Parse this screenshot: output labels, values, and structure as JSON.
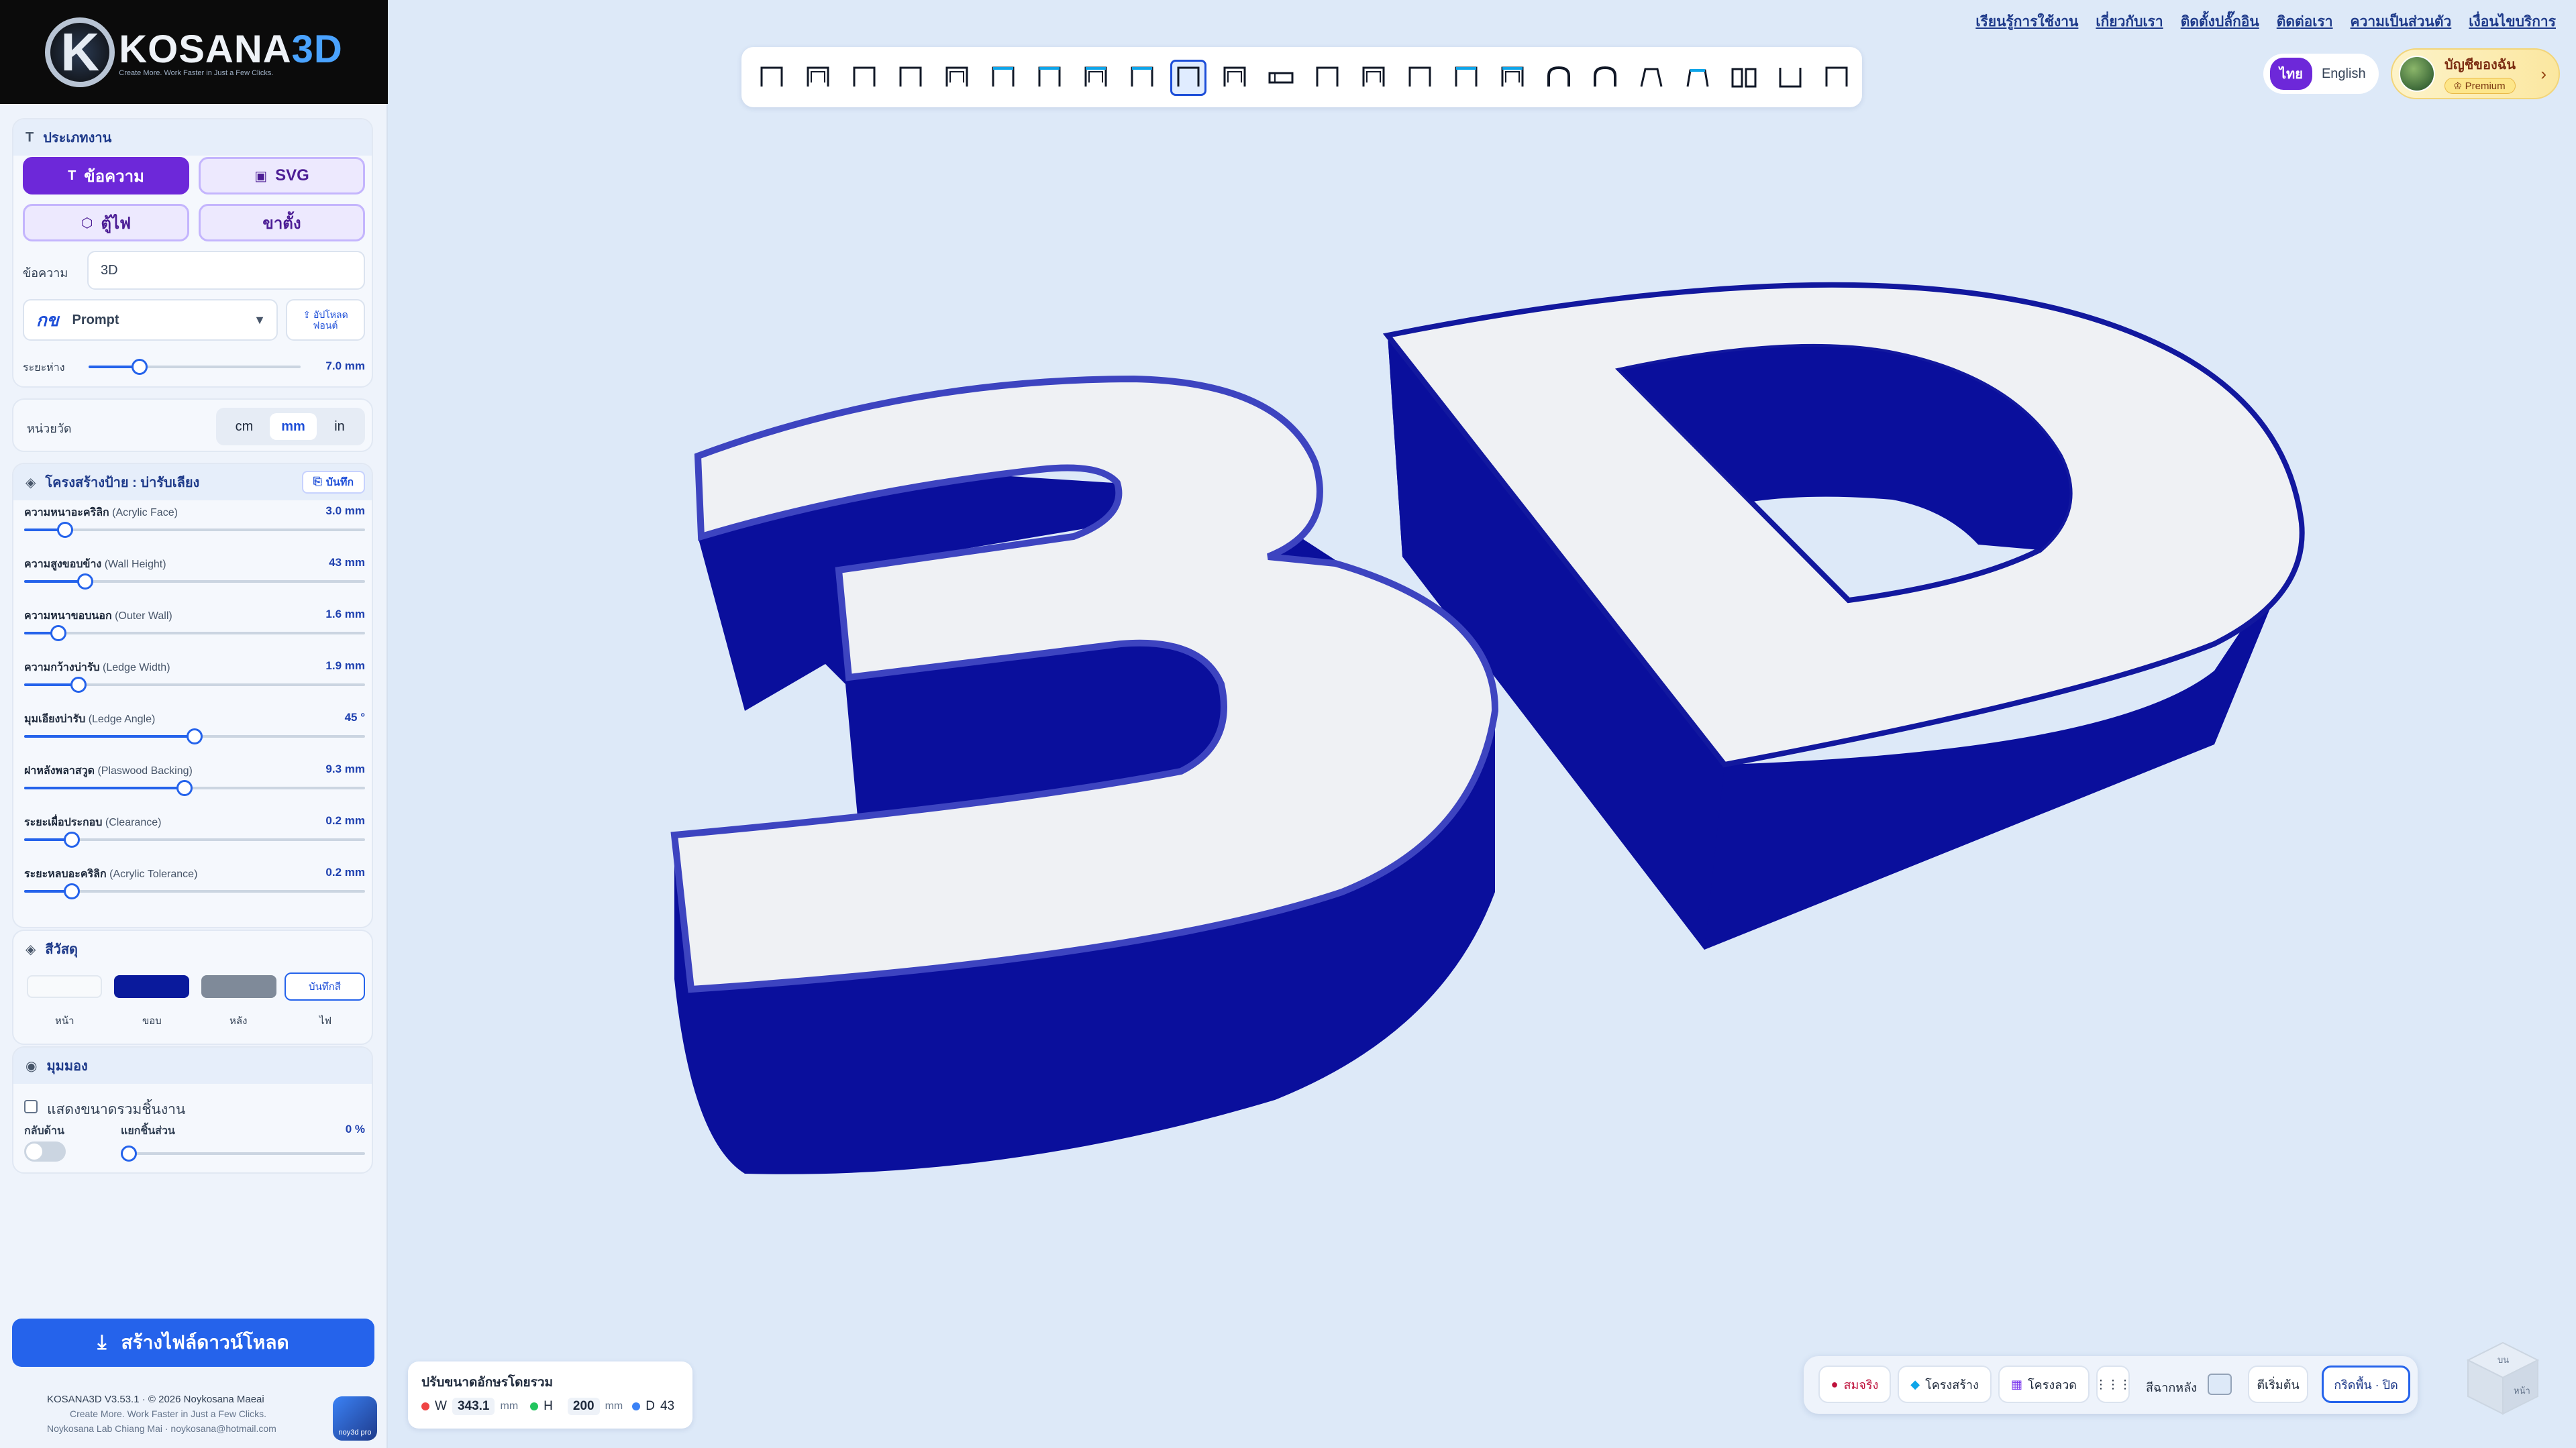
{
  "brand": {
    "name_a": "KOSANA",
    "name_b": "3D",
    "tagline": "Create More. Work Faster in Just a Few Clicks."
  },
  "type_card": {
    "header": "ประเภทงาน",
    "buttons": [
      {
        "label": "ข้อความ",
        "icon": "text-icon",
        "active": true
      },
      {
        "label": "SVG",
        "icon": "image-icon",
        "active": false
      },
      {
        "label": "ตู้ไฟ",
        "icon": "lightbox-icon",
        "active": false
      },
      {
        "label": "ขาตั้ง",
        "icon": "",
        "active": false
      }
    ],
    "text_label": "ข้อความ",
    "text_value": "3D",
    "font_glyph": "กข",
    "font_name": "Prompt",
    "upload_label_1": "อัปโหลด",
    "upload_label_2": "ฟอนต์",
    "spacing_label": "ระยะห่าง",
    "spacing_value": "7.0 mm",
    "spacing_fraction": 0.24
  },
  "units_card": {
    "label": "หน่วยวัด",
    "options": [
      "cm",
      "mm",
      "in"
    ],
    "selected": "mm"
  },
  "structure_card": {
    "header": "โครงสร้างป้าย : บ่ารับเลียง",
    "save_label": "บันทึก",
    "params": [
      {
        "label": "ความหนาอะคริลิก",
        "en": "(Acrylic Face)",
        "value": "3.0 mm",
        "fraction": 0.12
      },
      {
        "label": "ความสูงขอบข้าง",
        "en": "(Wall Height)",
        "value": "43 mm",
        "fraction": 0.18
      },
      {
        "label": "ความหนาขอบนอก",
        "en": "(Outer Wall)",
        "value": "1.6 mm",
        "fraction": 0.1
      },
      {
        "label": "ความกว้างบ่ารับ",
        "en": "(Ledge Width)",
        "value": "1.9 mm",
        "fraction": 0.16
      },
      {
        "label": "มุมเอียงบ่ารับ",
        "en": "(Ledge Angle)",
        "value": "45 °",
        "fraction": 0.5
      },
      {
        "label": "ฝาหลังพลาสวูด",
        "en": "(Plaswood Backing)",
        "value": "9.3 mm",
        "fraction": 0.47
      },
      {
        "label": "ระยะเผื่อประกอบ",
        "en": "(Clearance)",
        "value": "0.2 mm",
        "fraction": 0.14
      },
      {
        "label": "ระยะหลบอะคริลิก",
        "en": "(Acrylic Tolerance)",
        "value": "0.2 mm",
        "fraction": 0.14
      }
    ]
  },
  "material_card": {
    "header": "สีวัสดุ",
    "swatches": [
      {
        "label": "หน้า",
        "color": "#f8fafc"
      },
      {
        "label": "ขอบ",
        "color": "#0a1a9c"
      },
      {
        "label": "หลัง",
        "color": "#7f8a99"
      }
    ],
    "save_label": "บันทึกสี",
    "light_label": "ไฟ"
  },
  "view_card": {
    "header": "มุมมอง",
    "show_dims_label": "แสดงขนาดรวมชิ้นงาน",
    "flip_label": "กลับด้าน",
    "explode_label": "แยกชิ้นส่วน",
    "explode_value": "0 %"
  },
  "export_label": "สร้างไฟล์ดาวน์โหลด",
  "footer": {
    "line1": "KOSANA3D V3.53.1 · © 2026 Noykosana Maeai",
    "line2": "Create More. Work Faster in Just a Few Clicks.",
    "line3": "Noykosana Lab Chiang Mai · noykosana@hotmail.com",
    "app_icon_label": "noy3d pro"
  },
  "nav": [
    "เรียนรู้การใช้งาน",
    "เกี่ยวกับเรา",
    "ติดตั้งปลั๊กอิน",
    "ติดต่อเรา",
    "ความเป็นส่วนตัว",
    "เงื่อนไขบริการ"
  ],
  "lang": {
    "th": "ไทย",
    "en": "English",
    "selected": "th"
  },
  "account": {
    "name": "บัญชีของฉัน",
    "badge": "Premium"
  },
  "toolbar": {
    "selected_index": 9,
    "count": 24
  },
  "model_text": "3D",
  "model_colors": {
    "face": "#eff1f4",
    "side": "#0a0f9c",
    "rim": "#4d55c8",
    "background": "#dde9f8"
  },
  "dims_panel": {
    "title": "ปรับขนาดอักษรโดยรวม",
    "w_label": "W",
    "w_value": "343.1",
    "h_label": "H",
    "h_value": "200",
    "unit": "mm",
    "d_label": "D",
    "d_value": "43"
  },
  "viewbar": {
    "real_label": "สมจริง",
    "frame_label": "โครงสร้าง",
    "wire_label": "โครงลวด",
    "bg_label": "สีฉากหลัง",
    "reset_label": "ตีเริ่มต้น",
    "grid_label": "กริดพื้น · ปิด"
  },
  "cube_top": "บน",
  "cube_front": "หน้า"
}
